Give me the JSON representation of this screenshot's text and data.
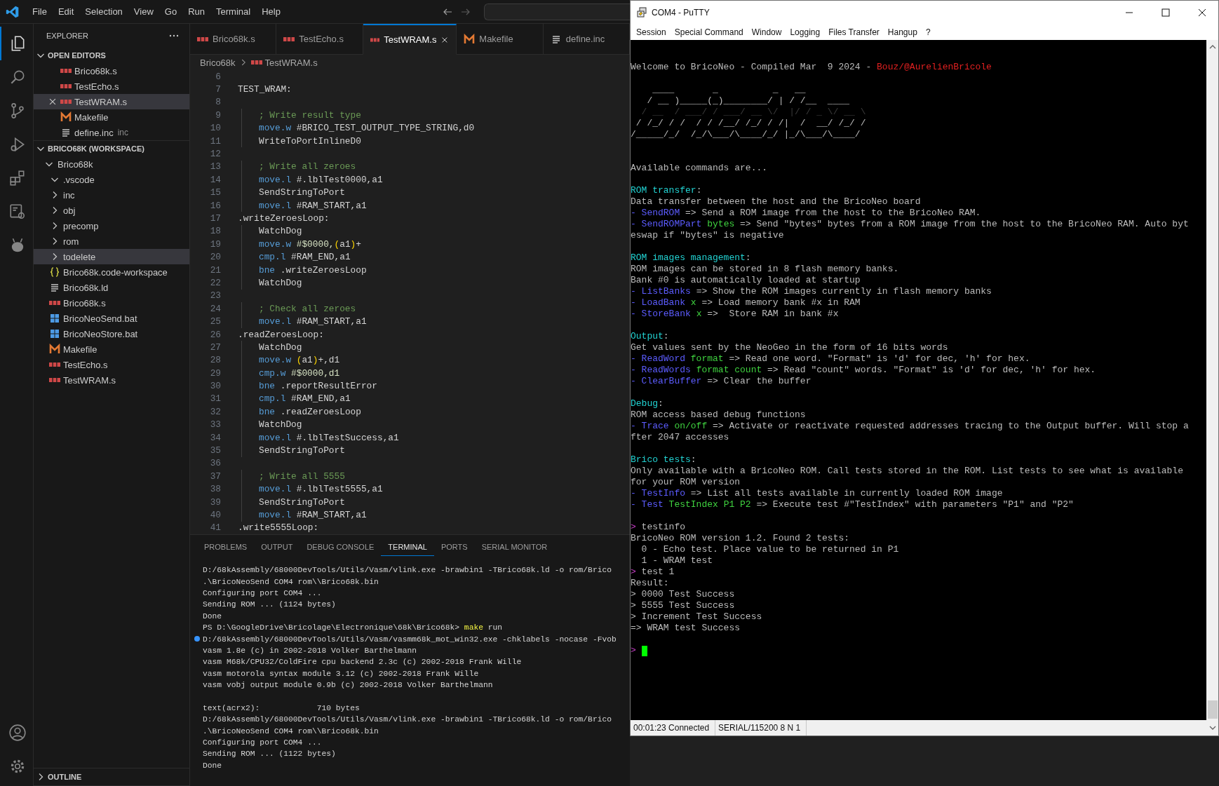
{
  "menu": [
    "File",
    "Edit",
    "Selection",
    "View",
    "Go",
    "Run",
    "Terminal",
    "Help"
  ],
  "activity_bar": {
    "top": [
      {
        "kind": "explorer",
        "selected": true
      },
      {
        "kind": "search",
        "selected": false
      },
      {
        "kind": "source-control",
        "selected": false
      },
      {
        "kind": "run-debug",
        "selected": false
      },
      {
        "kind": "extensions",
        "selected": false
      },
      {
        "kind": "remote",
        "selected": false
      },
      {
        "kind": "antenna-head",
        "selected": false
      }
    ],
    "bottom": [
      {
        "kind": "account"
      },
      {
        "kind": "settings"
      }
    ]
  },
  "sidebar": {
    "title": "EXPLORER",
    "open_editors": {
      "title": "OPEN EDITORS",
      "expanded": true,
      "items": [
        {
          "name": "Brico68k.s",
          "kind": "asm",
          "selected": false
        },
        {
          "name": "TestEcho.s",
          "kind": "asm",
          "selected": false
        },
        {
          "name": "TestWRAM.s",
          "kind": "asm",
          "selected": true
        },
        {
          "name": "Makefile",
          "kind": "make",
          "selected": false
        },
        {
          "name": "define.inc",
          "kind": "text",
          "description": "inc",
          "selected": false
        }
      ]
    },
    "workspace": {
      "title": "BRICO68K (WORKSPACE)",
      "expanded": true,
      "tree": [
        {
          "name": "Brico68k",
          "kind": "folder",
          "expanded": true,
          "selected": false,
          "children": [
            {
              "name": ".vscode",
              "kind": "folder",
              "expanded": true,
              "selected": false
            },
            {
              "name": "inc",
              "kind": "folder",
              "expanded": false,
              "selected": false
            },
            {
              "name": "obj",
              "kind": "folder",
              "expanded": false,
              "selected": false
            },
            {
              "name": "precomp",
              "kind": "folder",
              "expanded": false,
              "selected": false
            },
            {
              "name": "rom",
              "kind": "folder",
              "expanded": false,
              "selected": false
            },
            {
              "name": "todelete",
              "kind": "folder",
              "expanded": false,
              "selected": true
            },
            {
              "name": "Brico68k.code-workspace",
              "kind": "json",
              "selected": false
            },
            {
              "name": "Brico68k.ld",
              "kind": "text",
              "selected": false
            },
            {
              "name": "Brico68k.s",
              "kind": "asm",
              "selected": false
            },
            {
              "name": "BricoNeoSend.bat",
              "kind": "bat",
              "selected": false
            },
            {
              "name": "BricoNeoStore.bat",
              "kind": "bat",
              "selected": false
            },
            {
              "name": "Makefile",
              "kind": "make",
              "selected": false
            },
            {
              "name": "TestEcho.s",
              "kind": "asm",
              "selected": false
            },
            {
              "name": "TestWRAM.s",
              "kind": "asm",
              "selected": false
            }
          ]
        }
      ]
    },
    "outline": {
      "title": "OUTLINE",
      "expanded": false
    }
  },
  "tabs": [
    {
      "label": "Brico68k.s",
      "kind": "asm",
      "selected": false
    },
    {
      "label": "TestEcho.s",
      "kind": "asm",
      "selected": false
    },
    {
      "label": "TestWRAM.s",
      "kind": "asm",
      "selected": true
    },
    {
      "label": "Makefile",
      "kind": "make",
      "selected": false
    },
    {
      "label": "define.inc",
      "kind": "text",
      "selected": false
    }
  ],
  "breadcrumb": [
    {
      "label": "Brico68k"
    },
    {
      "label": "TestWRAM.s",
      "kind": "asm"
    }
  ],
  "editor": {
    "lines": [
      {
        "n": "6"
      },
      {
        "n": "7",
        "indent": false,
        "tokens": [
          {
            "t": "TEST_WRAM:",
            "kind": "plain"
          }
        ]
      },
      {
        "n": "8"
      },
      {
        "n": "9",
        "indent": true,
        "tokens": [
          {
            "t": "; Write result type",
            "kind": "comment"
          }
        ]
      },
      {
        "n": "10",
        "indent": true,
        "tokens": [
          {
            "t": "move.w",
            "kind": "kw"
          },
          {
            "t": " #BRICO_TEST_OUTPUT_TYPE_STRING,d0",
            "kind": "plain"
          }
        ]
      },
      {
        "n": "11",
        "indent": true,
        "tokens": [
          {
            "t": "WriteToPortInlineD0",
            "kind": "plain"
          }
        ]
      },
      {
        "n": "12"
      },
      {
        "n": "13",
        "indent": true,
        "tokens": [
          {
            "t": "; Write all zeroes",
            "kind": "comment"
          }
        ]
      },
      {
        "n": "14",
        "indent": true,
        "tokens": [
          {
            "t": "move.l",
            "kind": "kw"
          },
          {
            "t": " #.lblTest0000,a1",
            "kind": "plain"
          }
        ]
      },
      {
        "n": "15",
        "indent": true,
        "tokens": [
          {
            "t": "SendStringToPort",
            "kind": "plain"
          }
        ]
      },
      {
        "n": "16",
        "indent": true,
        "tokens": [
          {
            "t": "move.l",
            "kind": "kw"
          },
          {
            "t": " #RAM_START,a1",
            "kind": "plain"
          }
        ]
      },
      {
        "n": "17",
        "indent": false,
        "tokens": [
          {
            "t": ".writeZeroesLoop:",
            "kind": "plain"
          }
        ]
      },
      {
        "n": "18",
        "indent": true,
        "tokens": [
          {
            "t": "WatchDog",
            "kind": "plain"
          }
        ]
      },
      {
        "n": "19",
        "indent": true,
        "tokens": [
          {
            "t": "move.w",
            "kind": "kw"
          },
          {
            "t": " #$0000,",
            "kind": "num"
          },
          {
            "t": "(",
            "kind": "paren"
          },
          {
            "t": "a1",
            "kind": "plain"
          },
          {
            "t": ")",
            "kind": "paren"
          },
          {
            "t": "+",
            "kind": "plain"
          }
        ]
      },
      {
        "n": "20",
        "indent": true,
        "tokens": [
          {
            "t": "cmp.l",
            "kind": "kw"
          },
          {
            "t": " #RAM_END,a1",
            "kind": "plain"
          }
        ]
      },
      {
        "n": "21",
        "indent": true,
        "tokens": [
          {
            "t": "bne",
            "kind": "kw"
          },
          {
            "t": " .writeZeroesLoop",
            "kind": "plain"
          }
        ]
      },
      {
        "n": "22",
        "indent": true,
        "tokens": [
          {
            "t": "WatchDog",
            "kind": "plain"
          }
        ]
      },
      {
        "n": "23"
      },
      {
        "n": "24",
        "indent": true,
        "tokens": [
          {
            "t": "; Check all zeroes",
            "kind": "comment"
          }
        ]
      },
      {
        "n": "25",
        "indent": true,
        "tokens": [
          {
            "t": "move.l",
            "kind": "kw"
          },
          {
            "t": " #RAM_START,a1",
            "kind": "plain"
          }
        ]
      },
      {
        "n": "26",
        "indent": false,
        "tokens": [
          {
            "t": ".readZeroesLoop:",
            "kind": "plain"
          }
        ]
      },
      {
        "n": "27",
        "indent": true,
        "tokens": [
          {
            "t": "WatchDog",
            "kind": "plain"
          }
        ]
      },
      {
        "n": "28",
        "indent": true,
        "tokens": [
          {
            "t": "move.w",
            "kind": "kw"
          },
          {
            "t": " (",
            "kind": "paren"
          },
          {
            "t": "a1",
            "kind": "plain"
          },
          {
            "t": ")",
            "kind": "paren"
          },
          {
            "t": "+,d1",
            "kind": "plain"
          }
        ]
      },
      {
        "n": "29",
        "indent": true,
        "tokens": [
          {
            "t": "cmp.w",
            "kind": "kw"
          },
          {
            "t": " #$0000,d1",
            "kind": "num"
          }
        ]
      },
      {
        "n": "30",
        "indent": true,
        "tokens": [
          {
            "t": "bne",
            "kind": "kw"
          },
          {
            "t": " .reportResultError",
            "kind": "plain"
          }
        ]
      },
      {
        "n": "31",
        "indent": true,
        "tokens": [
          {
            "t": "cmp.l",
            "kind": "kw"
          },
          {
            "t": " #RAM_END,a1",
            "kind": "plain"
          }
        ]
      },
      {
        "n": "32",
        "indent": true,
        "tokens": [
          {
            "t": "bne",
            "kind": "kw"
          },
          {
            "t": " .readZeroesLoop",
            "kind": "plain"
          }
        ]
      },
      {
        "n": "33",
        "indent": true,
        "tokens": [
          {
            "t": "WatchDog",
            "kind": "plain"
          }
        ]
      },
      {
        "n": "34",
        "indent": true,
        "tokens": [
          {
            "t": "move.l",
            "kind": "kw"
          },
          {
            "t": " #.lblTestSuccess,a1",
            "kind": "plain"
          }
        ]
      },
      {
        "n": "35",
        "indent": true,
        "tokens": [
          {
            "t": "SendStringToPort",
            "kind": "plain"
          }
        ]
      },
      {
        "n": "36"
      },
      {
        "n": "37",
        "indent": true,
        "tokens": [
          {
            "t": "; Write all 5555",
            "kind": "comment"
          }
        ]
      },
      {
        "n": "38",
        "indent": true,
        "tokens": [
          {
            "t": "move.l",
            "kind": "kw"
          },
          {
            "t": " #.lblTest5555,a1",
            "kind": "plain"
          }
        ]
      },
      {
        "n": "39",
        "indent": true,
        "tokens": [
          {
            "t": "SendStringToPort",
            "kind": "plain"
          }
        ]
      },
      {
        "n": "40",
        "indent": true,
        "tokens": [
          {
            "t": "move.l",
            "kind": "kw"
          },
          {
            "t": " #RAM_START,a1",
            "kind": "plain"
          }
        ]
      },
      {
        "n": "41",
        "indent": false,
        "tokens": [
          {
            "t": ".write5555Loop:",
            "kind": "plain"
          }
        ]
      }
    ]
  },
  "panel": {
    "tabs": [
      {
        "label": "PROBLEMS",
        "selected": false
      },
      {
        "label": "OUTPUT",
        "selected": false
      },
      {
        "label": "DEBUG CONSOLE",
        "selected": false
      },
      {
        "label": "TERMINAL",
        "selected": true
      },
      {
        "label": "PORTS",
        "selected": false
      },
      {
        "label": "SERIAL MONITOR",
        "selected": false
      }
    ],
    "terminal": [
      {
        "kind": "output",
        "segs": [
          {
            "t": "D:/68kAssembly/68000DevTools/Utils/Vasm/vlink.exe -brawbin1 -TBrico68k.ld -o rom/Brico",
            "kind": "plain"
          }
        ]
      },
      {
        "kind": "output",
        "segs": [
          {
            "t": ".\\BricoNeoSend COM4 rom\\\\Brico68k.bin",
            "kind": "plain"
          }
        ]
      },
      {
        "kind": "output",
        "segs": [
          {
            "t": "Configuring port COM4 ...",
            "kind": "plain"
          }
        ]
      },
      {
        "kind": "output",
        "segs": [
          {
            "t": "Sending ROM ... (1124 bytes)",
            "kind": "plain"
          }
        ]
      },
      {
        "kind": "output",
        "segs": [
          {
            "t": "Done",
            "kind": "plain"
          }
        ]
      },
      {
        "kind": "output",
        "segs": [
          {
            "t": "PS D:\\GoogleDrive\\Bricolage\\Electronique\\68k\\Brico68k> ",
            "kind": "plain"
          },
          {
            "t": "make",
            "kind": "cmd"
          },
          {
            "t": " run",
            "kind": "plain"
          }
        ]
      },
      {
        "kind": "command",
        "segs": [
          {
            "t": "D:/68kAssembly/68000DevTools/Utils/Vasm/vasmm68k_mot_win32.exe -chklabels -nocase -Fvob",
            "kind": "plain"
          }
        ]
      },
      {
        "kind": "output",
        "segs": [
          {
            "t": "vasm 1.8e (c) in 2002-2018 Volker Barthelmann",
            "kind": "plain"
          }
        ]
      },
      {
        "kind": "output",
        "segs": [
          {
            "t": "vasm M68k/CPU32/ColdFire cpu backend 2.3c (c) 2002-2018 Frank Wille",
            "kind": "plain"
          }
        ]
      },
      {
        "kind": "output",
        "segs": [
          {
            "t": "vasm motorola syntax module 3.12 (c) 2002-2018 Frank Wille",
            "kind": "plain"
          }
        ]
      },
      {
        "kind": "output",
        "segs": [
          {
            "t": "vasm vobj output module 0.9b (c) 2002-2018 Volker Barthelmann",
            "kind": "plain"
          }
        ]
      },
      {
        "kind": "blank"
      },
      {
        "kind": "output",
        "segs": [
          {
            "t": "text(acrx2):            710 bytes",
            "kind": "plain"
          }
        ]
      },
      {
        "kind": "output",
        "segs": [
          {
            "t": "D:/68kAssembly/68000DevTools/Utils/Vasm/vlink.exe -brawbin1 -TBrico68k.ld -o rom/Brico",
            "kind": "plain"
          }
        ]
      },
      {
        "kind": "output",
        "segs": [
          {
            "t": ".\\BricoNeoSend COM4 rom\\\\Brico68k.bin",
            "kind": "plain"
          }
        ]
      },
      {
        "kind": "output",
        "segs": [
          {
            "t": "Configuring port COM4 ...",
            "kind": "plain"
          }
        ]
      },
      {
        "kind": "output",
        "segs": [
          {
            "t": "Sending ROM ... (1122 bytes)",
            "kind": "plain"
          }
        ]
      },
      {
        "kind": "output",
        "segs": [
          {
            "t": "Done",
            "kind": "plain"
          }
        ]
      }
    ]
  },
  "putty": {
    "title": "COM4 - PuTTY",
    "menu": [
      "Session",
      "Special Command",
      "Window",
      "Logging",
      "Files Transfer",
      "Hangup",
      "?"
    ],
    "lines": [
      {
        "kind": "text",
        "segs": [
          {
            "t": "Welcome to BricoNeo - Compiled Mar  9 2024 - ",
            "kind": "plain"
          },
          {
            "t": "Bouz/@AurelienBricole",
            "kind": "author"
          }
        ]
      },
      {
        "kind": "blank"
      },
      {
        "kind": "text",
        "segs": [
          {
            "t": "    ____       _          _   __",
            "kind": "plain"
          }
        ]
      },
      {
        "kind": "text",
        "segs": [
          {
            "t": "   / __ )_____(_)________/ | / /__  ____",
            "kind": "plain"
          }
        ]
      },
      {
        "kind": "text",
        "segs": [
          {
            "t": "  / __  / ___/ / ___/ __ \\/  |/ / _ \\/ __ \\",
            "kind": "dim"
          }
        ]
      },
      {
        "kind": "text",
        "segs": [
          {
            "t": " / /_/ / /  / / /__/ /_/ / /|  /  __/ /_/ /",
            "kind": "plain"
          }
        ]
      },
      {
        "kind": "text",
        "segs": [
          {
            "t": "/_____/_/  /_/\\___/\\____/_/ |_/\\___/\\____/",
            "kind": "plain"
          }
        ]
      },
      {
        "kind": "blank"
      },
      {
        "kind": "blank"
      },
      {
        "kind": "text",
        "segs": [
          {
            "t": "Available commands are...",
            "kind": "plain"
          }
        ]
      },
      {
        "kind": "blank"
      },
      {
        "kind": "text",
        "segs": [
          {
            "t": "ROM transfer",
            "kind": "head"
          },
          {
            "t": ":",
            "kind": "plain"
          }
        ]
      },
      {
        "kind": "text",
        "segs": [
          {
            "t": "Data transfer between the host and the BricoNeo board",
            "kind": "plain"
          }
        ]
      },
      {
        "kind": "text",
        "segs": [
          {
            "t": "- SendROM",
            "kind": "cmd"
          },
          {
            "t": " => Send a ROM image from the host to the BricoNeo RAM.",
            "kind": "plain"
          }
        ]
      },
      {
        "kind": "text",
        "segs": [
          {
            "t": "- SendROMPart",
            "kind": "cmd"
          },
          {
            "t": " bytes",
            "kind": "arg"
          },
          {
            "t": " => Send \"bytes\" bytes from a ROM image from the host to the BricoNeo RAM. Auto byt",
            "kind": "plain"
          }
        ]
      },
      {
        "kind": "text",
        "segs": [
          {
            "t": "eswap if \"bytes\" is negative",
            "kind": "plain"
          }
        ]
      },
      {
        "kind": "blank"
      },
      {
        "kind": "text",
        "segs": [
          {
            "t": "ROM images management",
            "kind": "head"
          },
          {
            "t": ":",
            "kind": "plain"
          }
        ]
      },
      {
        "kind": "text",
        "segs": [
          {
            "t": "ROM images can be stored in 8 flash memory banks.",
            "kind": "plain"
          }
        ]
      },
      {
        "kind": "text",
        "segs": [
          {
            "t": "Bank #0 is automatically loaded at startup",
            "kind": "plain"
          }
        ]
      },
      {
        "kind": "text",
        "segs": [
          {
            "t": "- ListBanks",
            "kind": "cmd"
          },
          {
            "t": " => Show the ROM images currently in flash memory banks",
            "kind": "plain"
          }
        ]
      },
      {
        "kind": "text",
        "segs": [
          {
            "t": "- LoadBank",
            "kind": "cmd"
          },
          {
            "t": " x",
            "kind": "arg"
          },
          {
            "t": " => Load memory bank #x in RAM",
            "kind": "plain"
          }
        ]
      },
      {
        "kind": "text",
        "segs": [
          {
            "t": "- StoreBank",
            "kind": "cmd"
          },
          {
            "t": " x",
            "kind": "arg"
          },
          {
            "t": " =>  Store RAM in bank #x",
            "kind": "plain"
          }
        ]
      },
      {
        "kind": "blank"
      },
      {
        "kind": "text",
        "segs": [
          {
            "t": "Output",
            "kind": "head"
          },
          {
            "t": ":",
            "kind": "plain"
          }
        ]
      },
      {
        "kind": "text",
        "segs": [
          {
            "t": "Get values sent by the NeoGeo in the form of 16 bits words",
            "kind": "plain"
          }
        ]
      },
      {
        "kind": "text",
        "segs": [
          {
            "t": "- ReadWord",
            "kind": "cmd"
          },
          {
            "t": " format",
            "kind": "arg"
          },
          {
            "t": " => Read one word. \"Format\" is 'd' for dec, 'h' for hex.",
            "kind": "plain"
          }
        ]
      },
      {
        "kind": "text",
        "segs": [
          {
            "t": "- ReadWords",
            "kind": "cmd"
          },
          {
            "t": " format count",
            "kind": "arg"
          },
          {
            "t": " => Read \"count\" words. \"Format\" is 'd' for dec, 'h' for hex.",
            "kind": "plain"
          }
        ]
      },
      {
        "kind": "text",
        "segs": [
          {
            "t": "- ClearBuffer",
            "kind": "cmd"
          },
          {
            "t": " => Clear the buffer",
            "kind": "plain"
          }
        ]
      },
      {
        "kind": "blank"
      },
      {
        "kind": "text",
        "segs": [
          {
            "t": "Debug",
            "kind": "head"
          },
          {
            "t": ":",
            "kind": "plain"
          }
        ]
      },
      {
        "kind": "text",
        "segs": [
          {
            "t": "ROM access based debug functions",
            "kind": "plain"
          }
        ]
      },
      {
        "kind": "text",
        "segs": [
          {
            "t": "- Trace",
            "kind": "cmd"
          },
          {
            "t": " on/off",
            "kind": "arg"
          },
          {
            "t": " => Activate or reactivate requested addresses tracing to the Output buffer. Will stop a",
            "kind": "plain"
          }
        ]
      },
      {
        "kind": "text",
        "segs": [
          {
            "t": "fter 2047 accesses",
            "kind": "plain"
          }
        ]
      },
      {
        "kind": "blank"
      },
      {
        "kind": "text",
        "segs": [
          {
            "t": "Brico tests",
            "kind": "head"
          },
          {
            "t": ":",
            "kind": "plain"
          }
        ]
      },
      {
        "kind": "text",
        "segs": [
          {
            "t": "Only available with a BricoNeo ROM. Call tests stored in the ROM. List tests to see what is available",
            "kind": "plain"
          }
        ]
      },
      {
        "kind": "text",
        "segs": [
          {
            "t": "for your ROM version",
            "kind": "plain"
          }
        ]
      },
      {
        "kind": "text",
        "segs": [
          {
            "t": "- TestInfo",
            "kind": "cmd"
          },
          {
            "t": " => List all tests available in currently loaded ROM image",
            "kind": "plain"
          }
        ]
      },
      {
        "kind": "text",
        "segs": [
          {
            "t": "- Test",
            "kind": "cmd"
          },
          {
            "t": " TestIndex P1 P2",
            "kind": "arg"
          },
          {
            "t": " => Execute test #\"TestIndex\" with parameters \"P1\" and \"P2\"",
            "kind": "plain"
          }
        ]
      },
      {
        "kind": "blank"
      },
      {
        "kind": "text",
        "segs": [
          {
            "t": ">",
            "kind": "prompt"
          },
          {
            "t": " testinfo",
            "kind": "plain"
          }
        ]
      },
      {
        "kind": "text",
        "segs": [
          {
            "t": "BricoNeo ROM version 1.2. Found 2 tests:",
            "kind": "plain"
          }
        ]
      },
      {
        "kind": "text",
        "segs": [
          {
            "t": "  0 - Echo test. Place value to be returned in P1",
            "kind": "plain"
          }
        ]
      },
      {
        "kind": "text",
        "segs": [
          {
            "t": "  1 - WRAM test",
            "kind": "plain"
          }
        ]
      },
      {
        "kind": "text",
        "segs": [
          {
            "t": ">",
            "kind": "prompt"
          },
          {
            "t": " test 1",
            "kind": "plain"
          }
        ]
      },
      {
        "kind": "text",
        "segs": [
          {
            "t": "Result:",
            "kind": "plain"
          }
        ]
      },
      {
        "kind": "text",
        "segs": [
          {
            "t": "> 0000 Test Success",
            "kind": "plain"
          }
        ]
      },
      {
        "kind": "text",
        "segs": [
          {
            "t": "> 5555 Test Success",
            "kind": "plain"
          }
        ]
      },
      {
        "kind": "text",
        "segs": [
          {
            "t": "> Increment Test Success",
            "kind": "plain"
          }
        ]
      },
      {
        "kind": "text",
        "segs": [
          {
            "t": "=> WRAM test Success",
            "kind": "plain"
          }
        ]
      },
      {
        "kind": "blank"
      },
      {
        "kind": "input",
        "segs": [
          {
            "t": ">",
            "kind": "prompt"
          }
        ]
      }
    ],
    "status": [
      "00:01:23 Connected",
      "SERIAL/115200 8 N 1"
    ]
  }
}
